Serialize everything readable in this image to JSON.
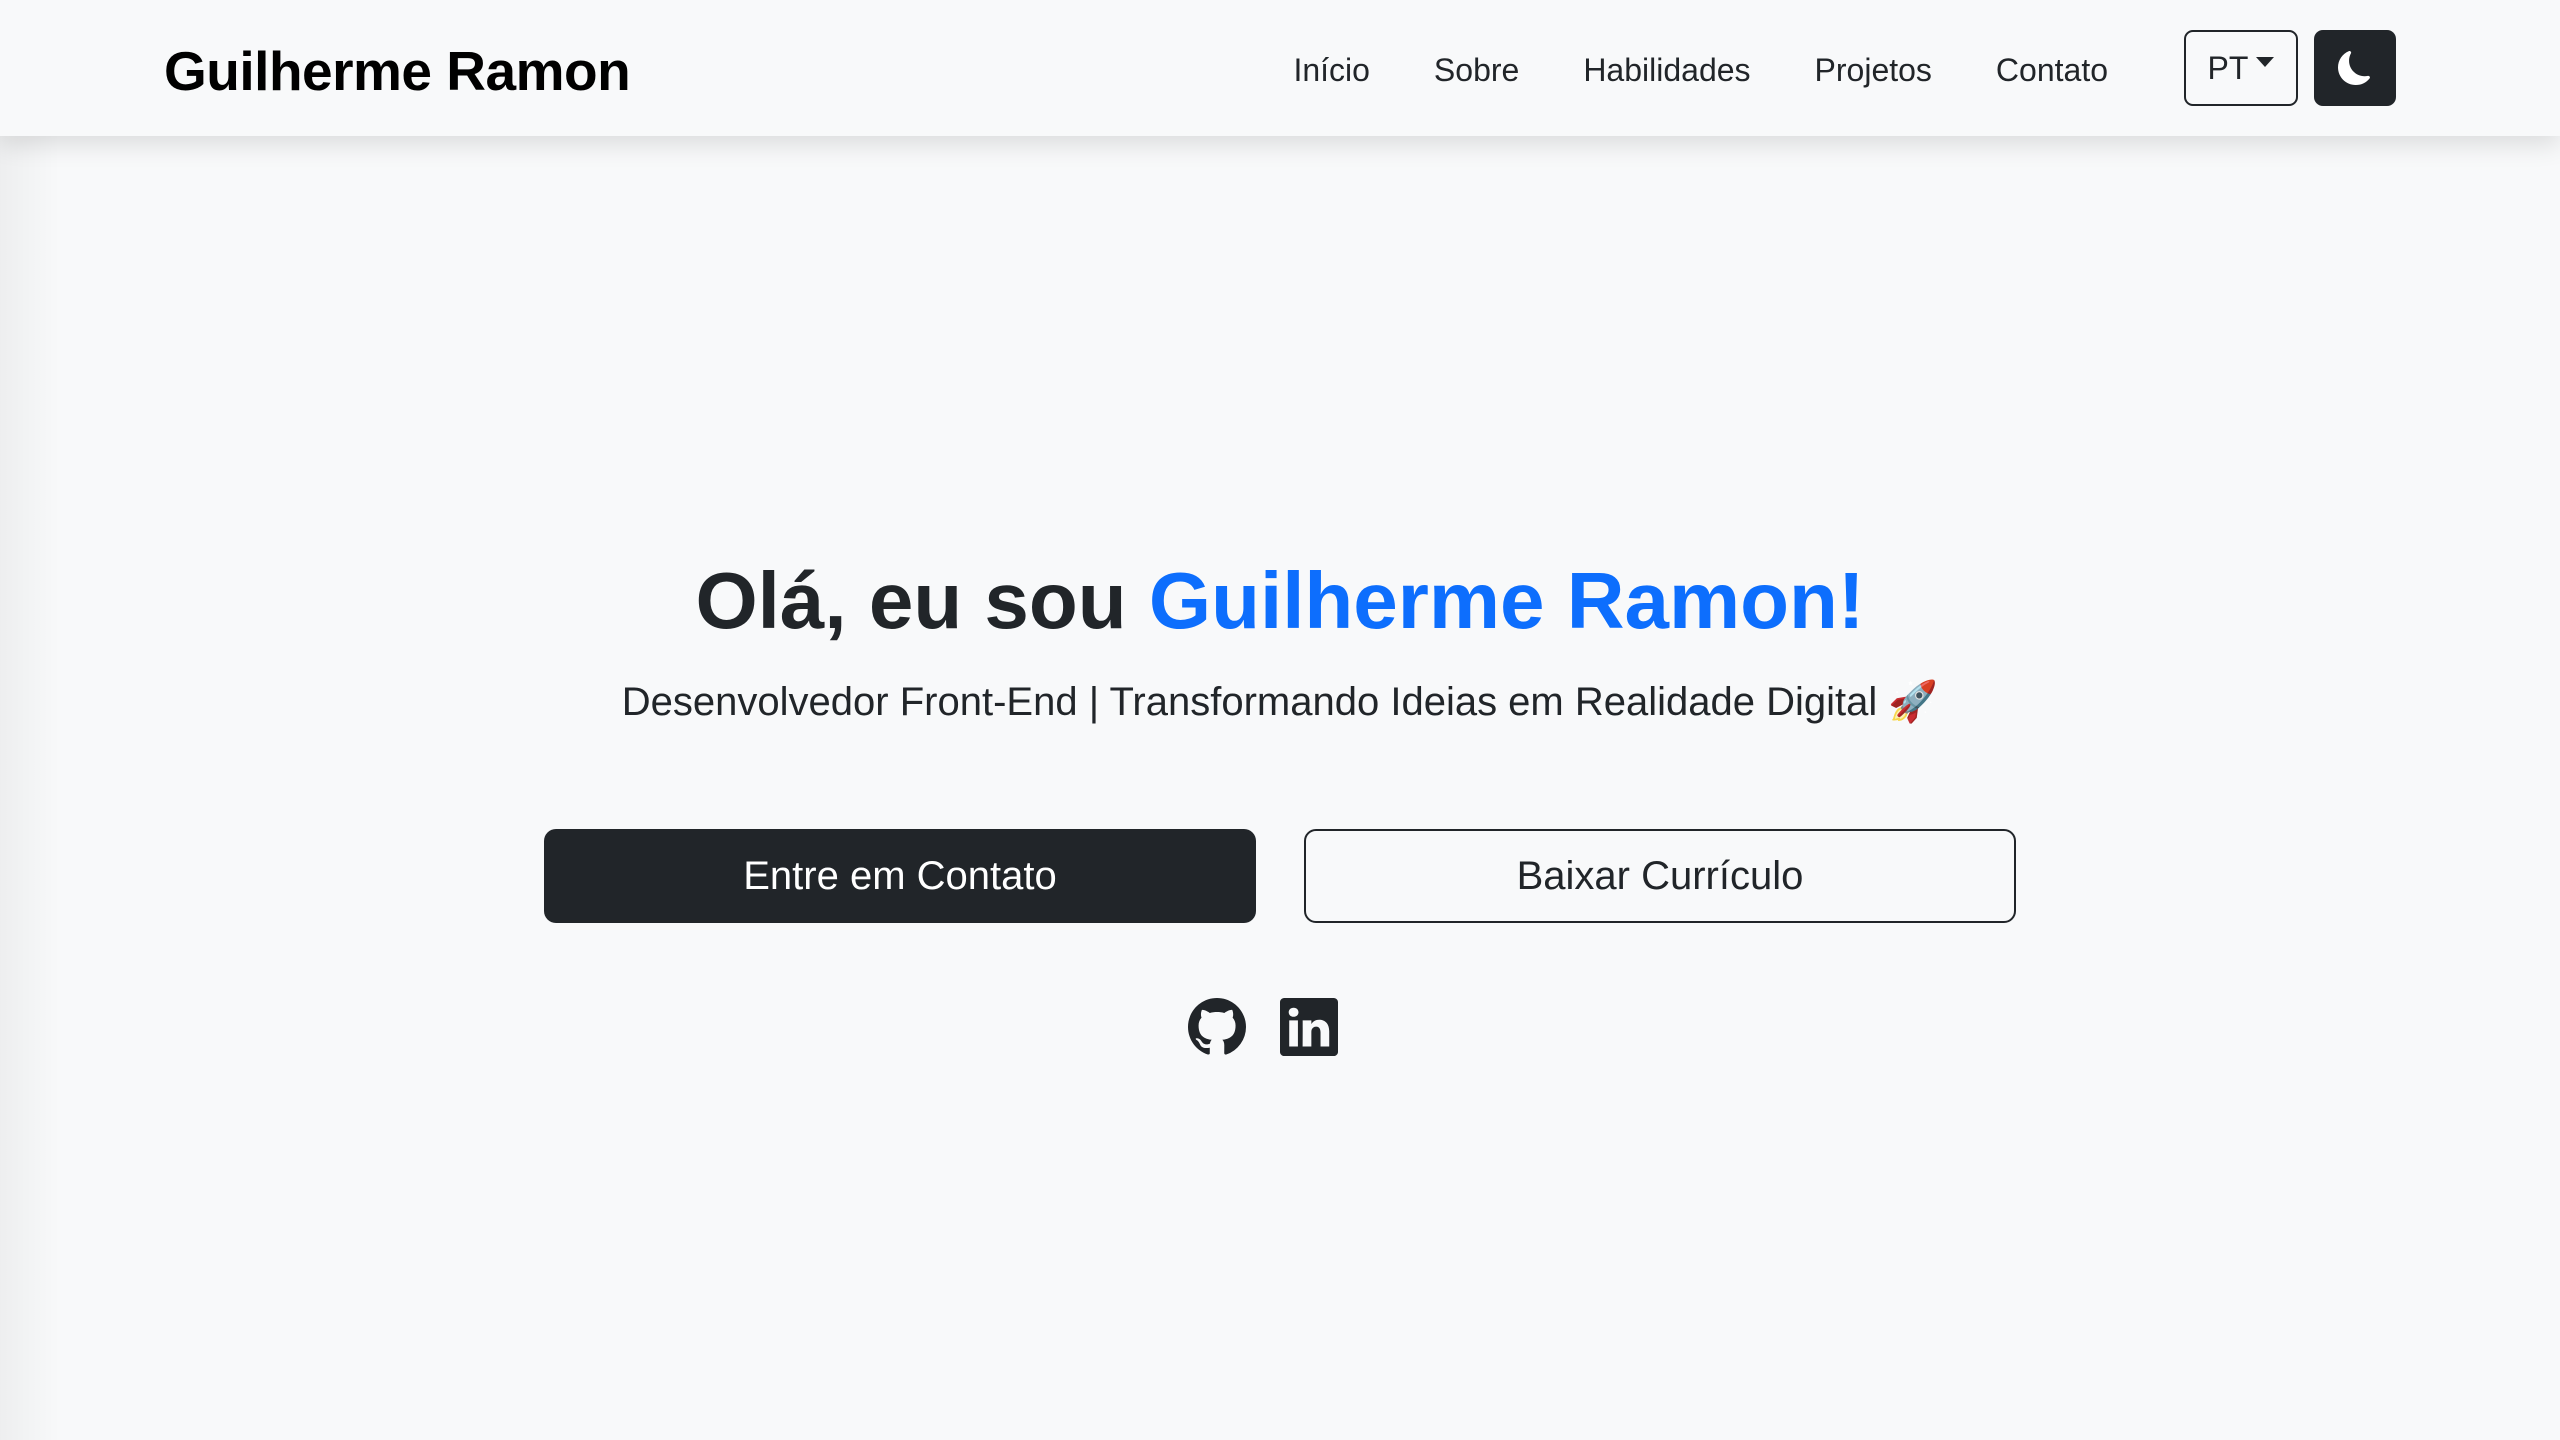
{
  "brand": "Guilherme Ramon",
  "nav": {
    "items": [
      "Início",
      "Sobre",
      "Habilidades",
      "Projetos",
      "Contato"
    ],
    "language": "PT",
    "theme_icon": "moon-icon"
  },
  "hero": {
    "greeting": "Olá, eu sou ",
    "name": "Guilherme Ramon!",
    "subtitle": "Desenvolvedor Front-End | Transformando Ideias em Realidade Digital 🚀",
    "primary_button": "Entre em Contato",
    "secondary_button": "Baixar Currículo",
    "social_icons": [
      "github-icon",
      "linkedin-icon"
    ]
  },
  "colors": {
    "accent": "#0d6efd",
    "dark": "#212529",
    "background": "#f8f9fa"
  }
}
